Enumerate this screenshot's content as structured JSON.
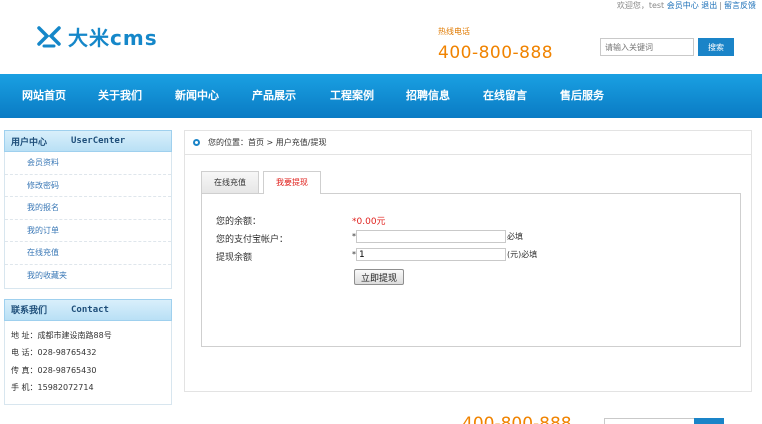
{
  "topbar": {
    "welcome": "欢迎您，",
    "username": "test",
    "member_center": "会员中心",
    "logout": "退出",
    "separator": "|",
    "feedback": "留言反馈"
  },
  "header": {
    "logo_text": "大米cms",
    "hotline_label": "热线电话",
    "hotline_number": "400-800-888",
    "search_placeholder": "请输入关键词",
    "search_button": "搜索"
  },
  "nav": {
    "items": [
      {
        "label": "网站首页"
      },
      {
        "label": "关于我们"
      },
      {
        "label": "新闻中心"
      },
      {
        "label": "产品展示"
      },
      {
        "label": "工程案例"
      },
      {
        "label": "招聘信息"
      },
      {
        "label": "在线留言"
      },
      {
        "label": "售后服务"
      }
    ]
  },
  "sidebar": {
    "user_title_cn": "用户中心",
    "user_title_en": "UserCenter",
    "items": [
      {
        "label": "会员资料"
      },
      {
        "label": "修改密码"
      },
      {
        "label": "我的报名"
      },
      {
        "label": "我的订单"
      },
      {
        "label": "在线充值"
      },
      {
        "label": "我的收藏夹"
      }
    ],
    "contact_title_cn": "联系我们",
    "contact_title_en": "Contact",
    "contact": [
      {
        "line": "地  址：成都市建设南路88号"
      },
      {
        "line": "电  话：028-98765432"
      },
      {
        "line": "传  真：028-98765430"
      },
      {
        "line": "手  机：15982072714"
      }
    ]
  },
  "main": {
    "breadcrumb": "您的位置：首页 > 用户充值/提现",
    "tabs": [
      {
        "label": "在线充值"
      },
      {
        "label": "我要提现"
      }
    ],
    "form": {
      "balance_label": "您的余额：",
      "balance_value": "*0.00元",
      "alipay_label": "您的支付宝帐户：",
      "alipay_star": "*",
      "alipay_value": "",
      "alipay_suffix": "必填",
      "amount_label": "提现余额",
      "amount_star": "*",
      "amount_value": "1",
      "amount_suffix": "(元)必填",
      "submit_label": "立即提现"
    }
  },
  "footer_peek": {
    "hotline_number": "400-800-888"
  },
  "colors": {
    "brand_blue": "#1a84c8",
    "hotline_orange": "#f08300",
    "alert_red": "#e0211d"
  }
}
